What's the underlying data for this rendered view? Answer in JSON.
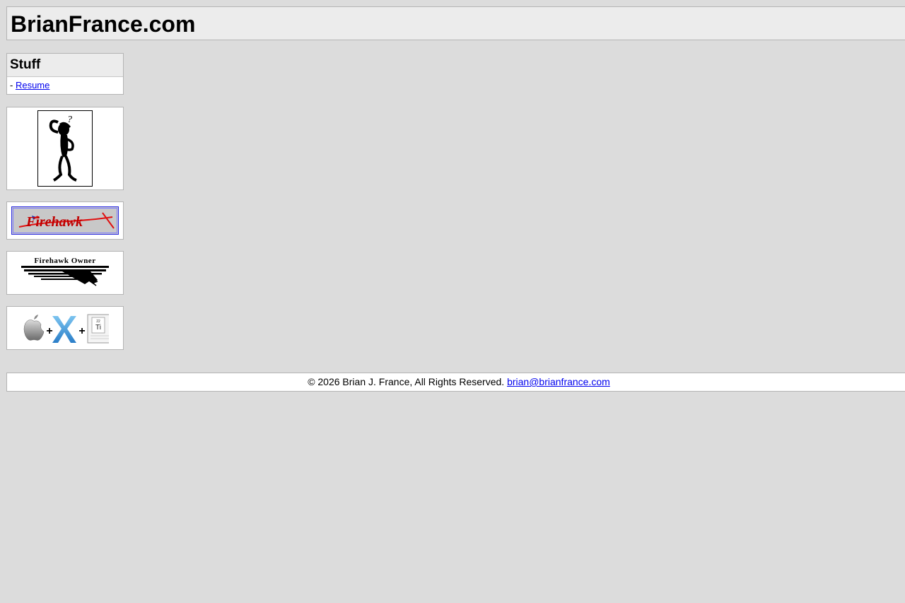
{
  "header": {
    "site_title": "BrianFrance.com"
  },
  "sidebar": {
    "stuff_title": "Stuff",
    "links": [
      {
        "prefix": "- ",
        "label": "Resume"
      }
    ],
    "images": [
      {
        "name": "thinking-stick-figure",
        "alt": "?"
      },
      {
        "name": "firehawk-logo",
        "text": "Firehawk"
      },
      {
        "name": "firehawk-owner-badge",
        "text": "Firehawk Owner"
      },
      {
        "name": "mac-os-x-titanium-badge",
        "plus": "+",
        "element_number": "22",
        "element_symbol": "Ti"
      }
    ]
  },
  "footer": {
    "copyright": "© 2026 Brian J. France, All Rights Reserved.",
    "email": "brian@brianfrance.com"
  },
  "colors": {
    "background": "#dcdcdc",
    "panel": "#ececec",
    "border": "#b4b4b4",
    "link": "#0000ee"
  }
}
